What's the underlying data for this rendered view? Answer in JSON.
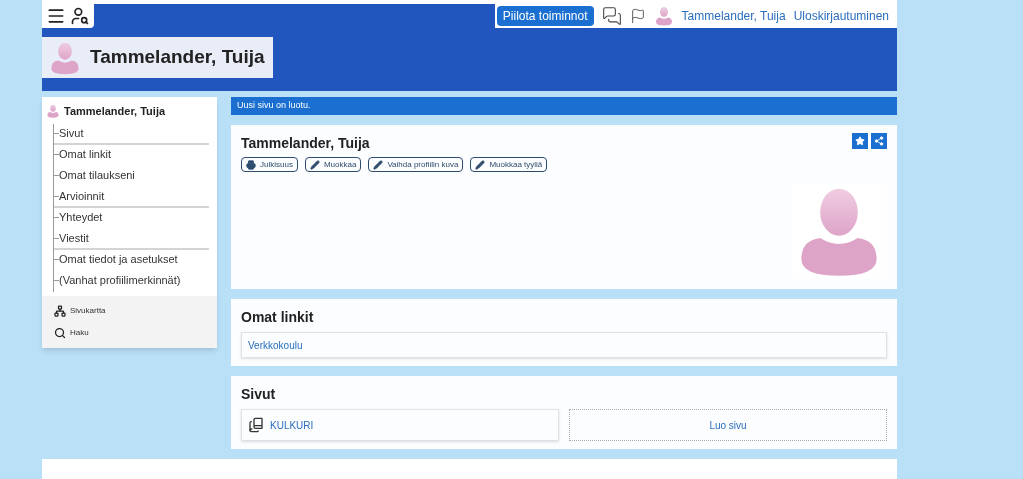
{
  "topbar": {
    "hide_button": "Piilota toiminnot",
    "user_link": "Tammelander, Tuija",
    "logout_link": "Uloskirjautuminen"
  },
  "header": {
    "title": "Tammelander, Tuija"
  },
  "sidebar": {
    "user": "Tammelander, Tuija",
    "items": [
      {
        "label": "Sivut",
        "divider_after": true
      },
      {
        "label": "Omat linkit",
        "divider_after": false
      },
      {
        "label": "Omat tilaukseni",
        "divider_after": false
      },
      {
        "label": "Arvioinnit",
        "divider_after": true
      },
      {
        "label": "Yhteydet",
        "divider_after": false
      },
      {
        "label": "Viestit",
        "divider_after": true
      },
      {
        "label": "Omat tiedot ja asetukset",
        "divider_after": false
      },
      {
        "label": "(Vanhat profiilimerkinnät)",
        "divider_after": false
      }
    ],
    "tools": [
      {
        "kind": "sitemap",
        "label": "Sivukartta"
      },
      {
        "kind": "search",
        "label": "Haku"
      }
    ]
  },
  "notice": "Uusi sivu on luotu.",
  "profile": {
    "title": "Tammelander, Tuija",
    "buttons": [
      {
        "kind": "print",
        "label": "Julkisuus"
      },
      {
        "kind": "edit",
        "label": "Muokkaa"
      },
      {
        "kind": "edit",
        "label": "Vaihda profiilin kuva"
      },
      {
        "kind": "edit",
        "label": "Muokkaa tyyliä"
      }
    ]
  },
  "links": {
    "title": "Omat linkit",
    "items": [
      "Verkkokoulu"
    ]
  },
  "pages": {
    "title": "Sivut",
    "items": [
      "KULKURI"
    ],
    "create": "Luo sivu"
  }
}
